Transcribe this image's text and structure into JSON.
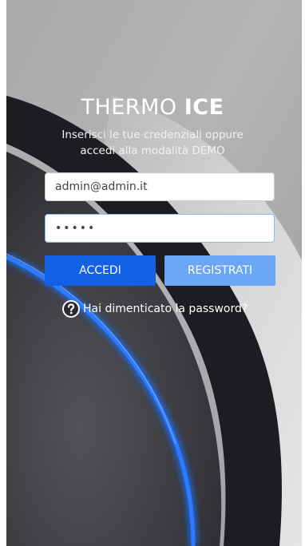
{
  "login": {
    "title_light": "THERMO",
    "title_bold": "ICE",
    "subtitle_line1": "Inserisci le tue credenziali oppure",
    "subtitle_line2": "accedi alla modalità DEMO",
    "email_value": "admin@admin.it",
    "password_value": "•••••",
    "login_label": "ACCEDI",
    "register_label": "REGISTRATI",
    "forgot_label": "Hai dimenticato la password?",
    "forgot_icon": "question-circle-icon"
  },
  "colors": {
    "primary": "#1160e6",
    "secondary": "#6aa6f3",
    "ring": "#1f6cf2"
  }
}
